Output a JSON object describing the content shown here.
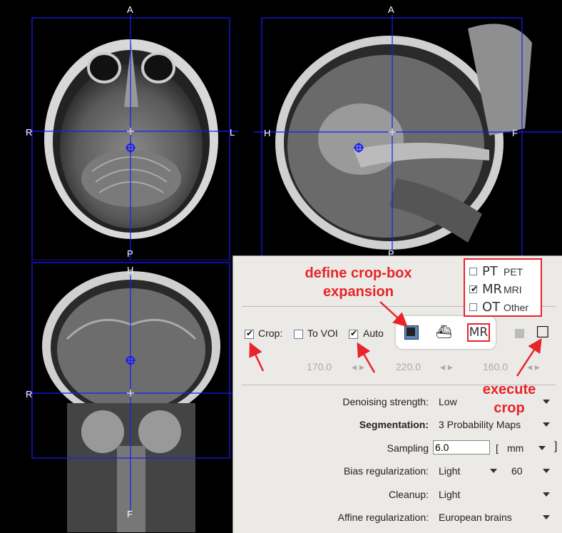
{
  "views": {
    "axial": {
      "top": "A",
      "bottom": "P",
      "left": "R",
      "right": "L"
    },
    "sagittal": {
      "top": "A",
      "bottom": "P",
      "left": "H",
      "right": "F"
    },
    "coronal": {
      "top": "H",
      "bottom": "F",
      "left": "R",
      "right": ""
    }
  },
  "crop": {
    "crop_label": "Crop:",
    "to_voi_label": "To VOI",
    "auto_label": "Auto",
    "crop_checked": true,
    "to_voi_checked": false,
    "auto_checked": true
  },
  "modality_popup": {
    "items": [
      {
        "code": "PT",
        "label": "PET",
        "checked": false
      },
      {
        "code": "MR",
        "label": "MRI",
        "checked": true
      },
      {
        "code": "OT",
        "label": "Other",
        "checked": false
      }
    ]
  },
  "mode_button_label": "MR",
  "crop_values": {
    "v1": "170.0",
    "v2": "220.0",
    "v3": "160.0"
  },
  "settings": {
    "denoising_label": "Denoising strength:",
    "denoising_value": "Low",
    "segmentation_label": "Segmentation:",
    "segmentation_value": "3 Probability Maps",
    "sampling_label": "Sampling",
    "sampling_value": "6.0",
    "sampling_bracket": "[",
    "sampling_unit": "mm",
    "bias_label": "Bias regularization:",
    "bias_value": "Light",
    "bias_value2": "60",
    "cleanup_label": "Cleanup:",
    "cleanup_value": "Light",
    "affine_label": "Affine regularization:",
    "affine_value": "European brains"
  },
  "annotations": {
    "define_line1": "define crop-box",
    "define_line2": "expansion",
    "execute_line1": "execute",
    "execute_line2": "crop"
  },
  "colors": {
    "crosshair": "#1a1aff",
    "annotation": "#e8242a",
    "panel": "#eceae6"
  }
}
